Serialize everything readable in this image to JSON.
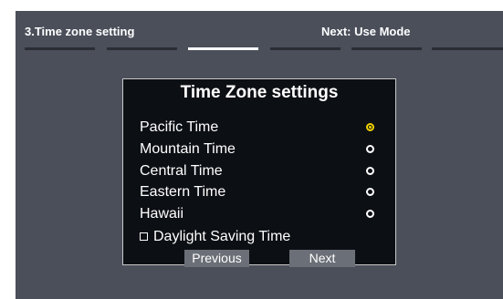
{
  "header": {
    "step_title": "3.Time zone setting",
    "next_title": "Next: Use Mode"
  },
  "progress": {
    "total_steps": 6,
    "current_step": 3
  },
  "dialog": {
    "title": "Time Zone settings",
    "options": [
      {
        "label": "Pacific Time",
        "selected": true
      },
      {
        "label": "Mountain Time",
        "selected": false
      },
      {
        "label": "Central Time",
        "selected": false
      },
      {
        "label": "Eastern Time",
        "selected": false
      },
      {
        "label": "Hawaii",
        "selected": false
      }
    ],
    "daylight_saving": {
      "label": "Daylight Saving Time",
      "checked": false
    },
    "previous_label": "Previous",
    "next_label": "Next"
  },
  "colors": {
    "screen_bg": "#4a4f5a",
    "dialog_bg": "#0c0f14",
    "button_bg": "#6b6f77",
    "selected_radio": "#f0d000"
  }
}
